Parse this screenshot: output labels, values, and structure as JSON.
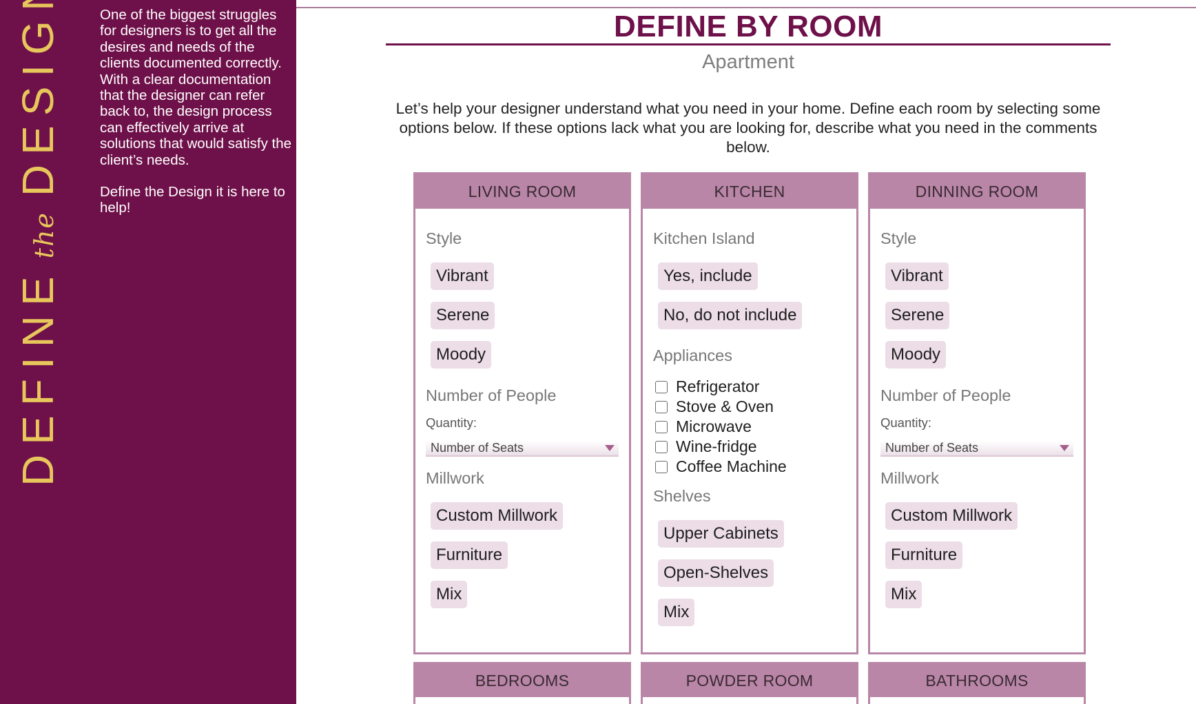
{
  "sidebar": {
    "brand": {
      "word1": "DEFINE",
      "the": "the",
      "word2": "DESIGN"
    },
    "paragraph1": "One of the biggest struggles for designers is to get all the desires and needs of the clients documented correctly. With a clear documentation that the designer can refer back to, the design process can effectively arrive at solutions that would satisfy the client’s needs.",
    "paragraph2": "Define the Design it is here to help!"
  },
  "main": {
    "title": "DEFINE BY ROOM",
    "subtitle": "Apartment",
    "intro": "Let’s help your designer understand what you need in your home. Define each room by selecting some options below. If these options lack what you are looking for, describe what you need in the comments below."
  },
  "rooms": {
    "living": {
      "title": "LIVING ROOM",
      "style_label": "Style",
      "style_options": [
        "Vibrant",
        "Serene",
        "Moody"
      ],
      "people_label": "Number of People",
      "quantity_label": "Quantity:",
      "seats_value": "Number of Seats",
      "millwork_label": "Millwork",
      "millwork_options": [
        "Custom Millwork",
        "Furniture",
        "Mix"
      ]
    },
    "kitchen": {
      "title": "KITCHEN",
      "island_label": "Kitchen Island",
      "island_options": [
        "Yes, include",
        "No, do not include"
      ],
      "appliances_label": "Appliances",
      "appliances": [
        "Refrigerator",
        "Stove & Oven",
        "Microwave",
        "Wine-fridge",
        "Coffee Machine"
      ],
      "shelves_label": "Shelves",
      "shelves_options": [
        "Upper Cabinets",
        "Open-Shelves",
        "Mix"
      ]
    },
    "dining": {
      "title": "DINNING ROOM",
      "style_label": "Style",
      "style_options": [
        "Vibrant",
        "Serene",
        "Moody"
      ],
      "people_label": "Number of People",
      "quantity_label": "Quantity:",
      "seats_value": "Number of Seats",
      "millwork_label": "Millwork",
      "millwork_options": [
        "Custom Millwork",
        "Furniture",
        "Mix"
      ]
    },
    "bottom": [
      "BEDROOMS",
      "POWDER ROOM",
      "BATHROOMS"
    ]
  },
  "colors": {
    "sidebar_bg": "#6e1049",
    "brand_gold": "#e7c65c",
    "card_accent": "#b986a7",
    "chip_bg": "#ecdde7"
  }
}
